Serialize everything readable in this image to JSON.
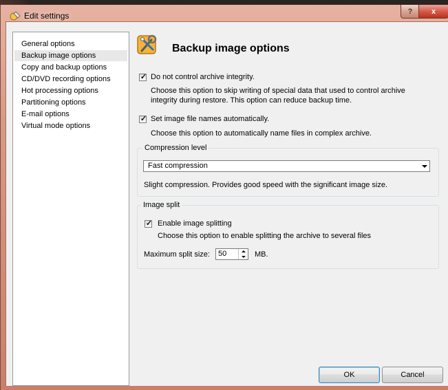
{
  "window": {
    "title": "Edit settings",
    "help_label": "?",
    "close_label": "x"
  },
  "nav": {
    "items": [
      {
        "label": "General options",
        "selected": false
      },
      {
        "label": "Backup image options",
        "selected": true
      },
      {
        "label": "Copy and backup options",
        "selected": false
      },
      {
        "label": "CD/DVD recording options",
        "selected": false
      },
      {
        "label": "Hot processing options",
        "selected": false
      },
      {
        "label": "Partitioning options",
        "selected": false
      },
      {
        "label": "E-mail options",
        "selected": false
      },
      {
        "label": "Virtual mode options",
        "selected": false
      }
    ]
  },
  "panel": {
    "title": "Backup image options",
    "icon": "settings-tools-icon",
    "integrity": {
      "label": "Do not control archive integrity.",
      "checked": true,
      "description": "Choose this option to skip writing of special data that used to control archive integrity during restore. This option can reduce backup time."
    },
    "auto_names": {
      "label": "Set image file names automatically.",
      "checked": true,
      "description": "Choose this option to automatically name files in complex archive."
    },
    "compression": {
      "group_label": "Compression level",
      "value": "Fast compression",
      "description": "Slight compression. Provides good speed with the significant image size."
    },
    "split": {
      "group_label": "Image split",
      "enable_label": "Enable image splitting",
      "enabled": true,
      "description": "Choose this option to enable splitting the archive to several files",
      "max_size_label": "Maximum split size:",
      "max_size_value": "50",
      "unit": "MB."
    }
  },
  "buttons": {
    "ok": "OK",
    "cancel": "Cancel"
  },
  "colors": {
    "frame": "#d79a86",
    "close_button": "#d55b4b",
    "client_background": "#f0f0f0"
  }
}
